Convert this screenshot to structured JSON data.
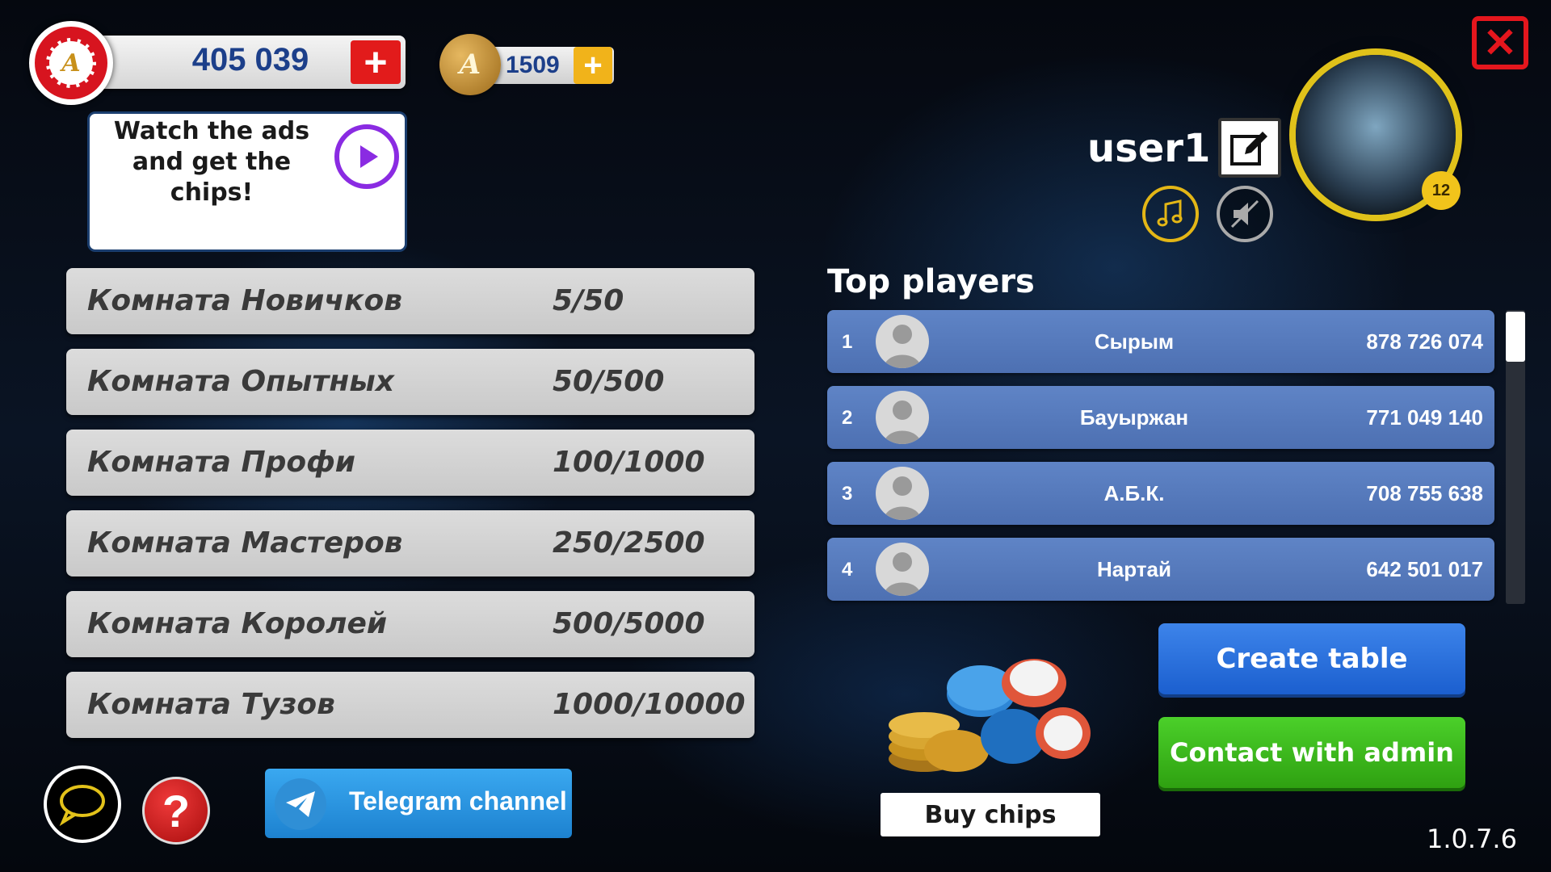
{
  "header": {
    "chips_balance": "405 039",
    "gold_balance": "1509",
    "chip_logo_letter": "A",
    "gold_logo_letter": "A"
  },
  "ads": {
    "text": "Watch the ads\nand get the\nchips!"
  },
  "rooms": [
    {
      "name": "Комната Новичков",
      "stake": "5/50"
    },
    {
      "name": "Комната Опытных",
      "stake": "50/500"
    },
    {
      "name": "Комната Профи",
      "stake": "100/1000"
    },
    {
      "name": "Комната Мастеров",
      "stake": "250/2500"
    },
    {
      "name": "Комната Королей",
      "stake": "500/5000"
    },
    {
      "name": "Комната Тузов",
      "stake": "1000/10000"
    }
  ],
  "profile": {
    "username": "user1",
    "level": "12"
  },
  "top_players": {
    "title": "Top players",
    "rows": [
      {
        "rank": "1",
        "name": "Сырым",
        "score": "878 726 074"
      },
      {
        "rank": "2",
        "name": "Бауыржан",
        "score": "771 049 140"
      },
      {
        "rank": "3",
        "name": "А.Б.К.",
        "score": "708 755 638"
      },
      {
        "rank": "4",
        "name": "Нартай",
        "score": "642 501 017"
      }
    ]
  },
  "buttons": {
    "telegram": "Telegram channel",
    "buy_chips": "Buy chips",
    "create_table": "Create table",
    "contact_admin": "Contact with admin",
    "help": "?"
  },
  "version": "1.0.7.6",
  "colors": {
    "chip_red": "#e21b1b",
    "gold": "#f1b31a",
    "player_row": "#5579bb",
    "create_blue": "#2a6fdc",
    "contact_green": "#3cb81c",
    "telegram_blue": "#2a95e0"
  }
}
